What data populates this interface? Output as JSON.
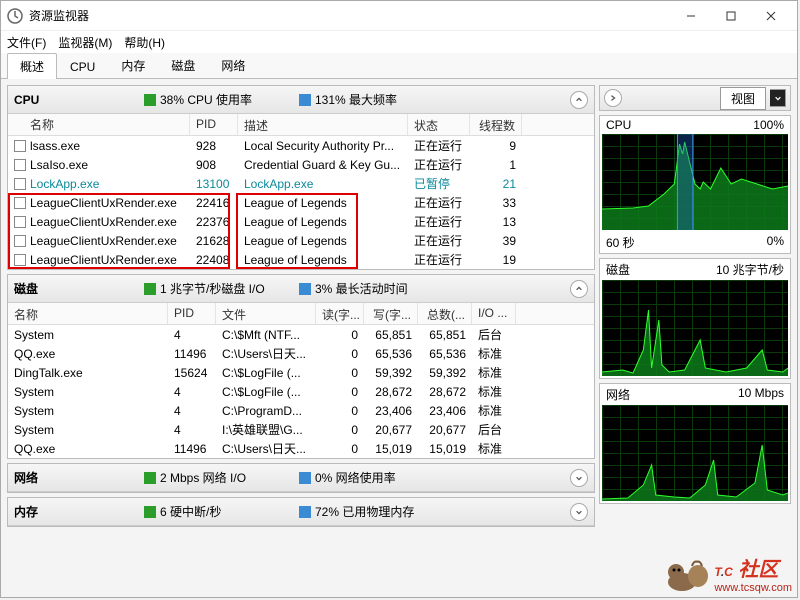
{
  "window": {
    "title": "资源监视器"
  },
  "menubar": [
    "文件(F)",
    "监视器(M)",
    "帮助(H)"
  ],
  "tabs": [
    "概述",
    "CPU",
    "内存",
    "磁盘",
    "网络"
  ],
  "activeTab": 0,
  "rightToolbar": {
    "view": "视图"
  },
  "cpu": {
    "title": "CPU",
    "stat1": "38% CPU 使用率",
    "stat2": "131% 最大频率",
    "cols": [
      "名称",
      "PID",
      "描述",
      "状态",
      "线程数"
    ],
    "rows": [
      {
        "name": "lsass.exe",
        "pid": "928",
        "desc": "Local Security Authority Pr...",
        "status": "正在运行",
        "threads": "9",
        "teal": false
      },
      {
        "name": "LsaIso.exe",
        "pid": "908",
        "desc": "Credential Guard & Key Gu...",
        "status": "正在运行",
        "threads": "1",
        "teal": false
      },
      {
        "name": "LockApp.exe",
        "pid": "13100",
        "desc": "LockApp.exe",
        "status": "已暂停",
        "threads": "21",
        "teal": true
      },
      {
        "name": "LeagueClientUxRender.exe",
        "pid": "22416",
        "desc": "League of Legends",
        "status": "正在运行",
        "threads": "33",
        "teal": false
      },
      {
        "name": "LeagueClientUxRender.exe",
        "pid": "22376",
        "desc": "League of Legends",
        "status": "正在运行",
        "threads": "13",
        "teal": false
      },
      {
        "name": "LeagueClientUxRender.exe",
        "pid": "21628",
        "desc": "League of Legends",
        "status": "正在运行",
        "threads": "39",
        "teal": false
      },
      {
        "name": "LeagueClientUxRender.exe",
        "pid": "22408",
        "desc": "League of Legends",
        "status": "正在运行",
        "threads": "19",
        "teal": false
      }
    ]
  },
  "disk": {
    "title": "磁盘",
    "stat1": "1 兆字节/秒磁盘 I/O",
    "stat2": "3% 最长活动时间",
    "cols": [
      "名称",
      "PID",
      "文件",
      "读(字...",
      "写(字...",
      "总数(...",
      "I/O ..."
    ],
    "rows": [
      {
        "name": "System",
        "pid": "4",
        "file": "C:\\$Mft (NTF...",
        "r": "0",
        "w": "65,851",
        "t": "65,851",
        "io": "后台"
      },
      {
        "name": "QQ.exe",
        "pid": "11496",
        "file": "C:\\Users\\日天...",
        "r": "0",
        "w": "65,536",
        "t": "65,536",
        "io": "标准"
      },
      {
        "name": "DingTalk.exe",
        "pid": "15624",
        "file": "C:\\$LogFile (...",
        "r": "0",
        "w": "59,392",
        "t": "59,392",
        "io": "标准"
      },
      {
        "name": "System",
        "pid": "4",
        "file": "C:\\$LogFile (...",
        "r": "0",
        "w": "28,672",
        "t": "28,672",
        "io": "标准"
      },
      {
        "name": "System",
        "pid": "4",
        "file": "C:\\ProgramD...",
        "r": "0",
        "w": "23,406",
        "t": "23,406",
        "io": "标准"
      },
      {
        "name": "System",
        "pid": "4",
        "file": "I:\\英雄联盟\\G...",
        "r": "0",
        "w": "20,677",
        "t": "20,677",
        "io": "后台"
      },
      {
        "name": "QQ.exe",
        "pid": "11496",
        "file": "C:\\Users\\日天...",
        "r": "0",
        "w": "15,019",
        "t": "15,019",
        "io": "标准"
      }
    ]
  },
  "net": {
    "title": "网络",
    "stat1": "2 Mbps 网络 I/O",
    "stat2": "0% 网络使用率"
  },
  "mem": {
    "title": "内存",
    "stat1": "6 硬中断/秒",
    "stat2": "72% 已用物理内存"
  },
  "graphs": {
    "g1": {
      "topL": "CPU",
      "topR": "100%",
      "botL": "60 秒",
      "botR": "0%"
    },
    "g2": {
      "topL": "磁盘",
      "topR": "10 兆字节/秒"
    },
    "g3": {
      "topL": "网络",
      "topR": "10 Mbps"
    }
  },
  "watermark": {
    "brand1": "T",
    "brand2": "C",
    "brand3": "社区",
    "url": "www.tcsqw.com"
  }
}
